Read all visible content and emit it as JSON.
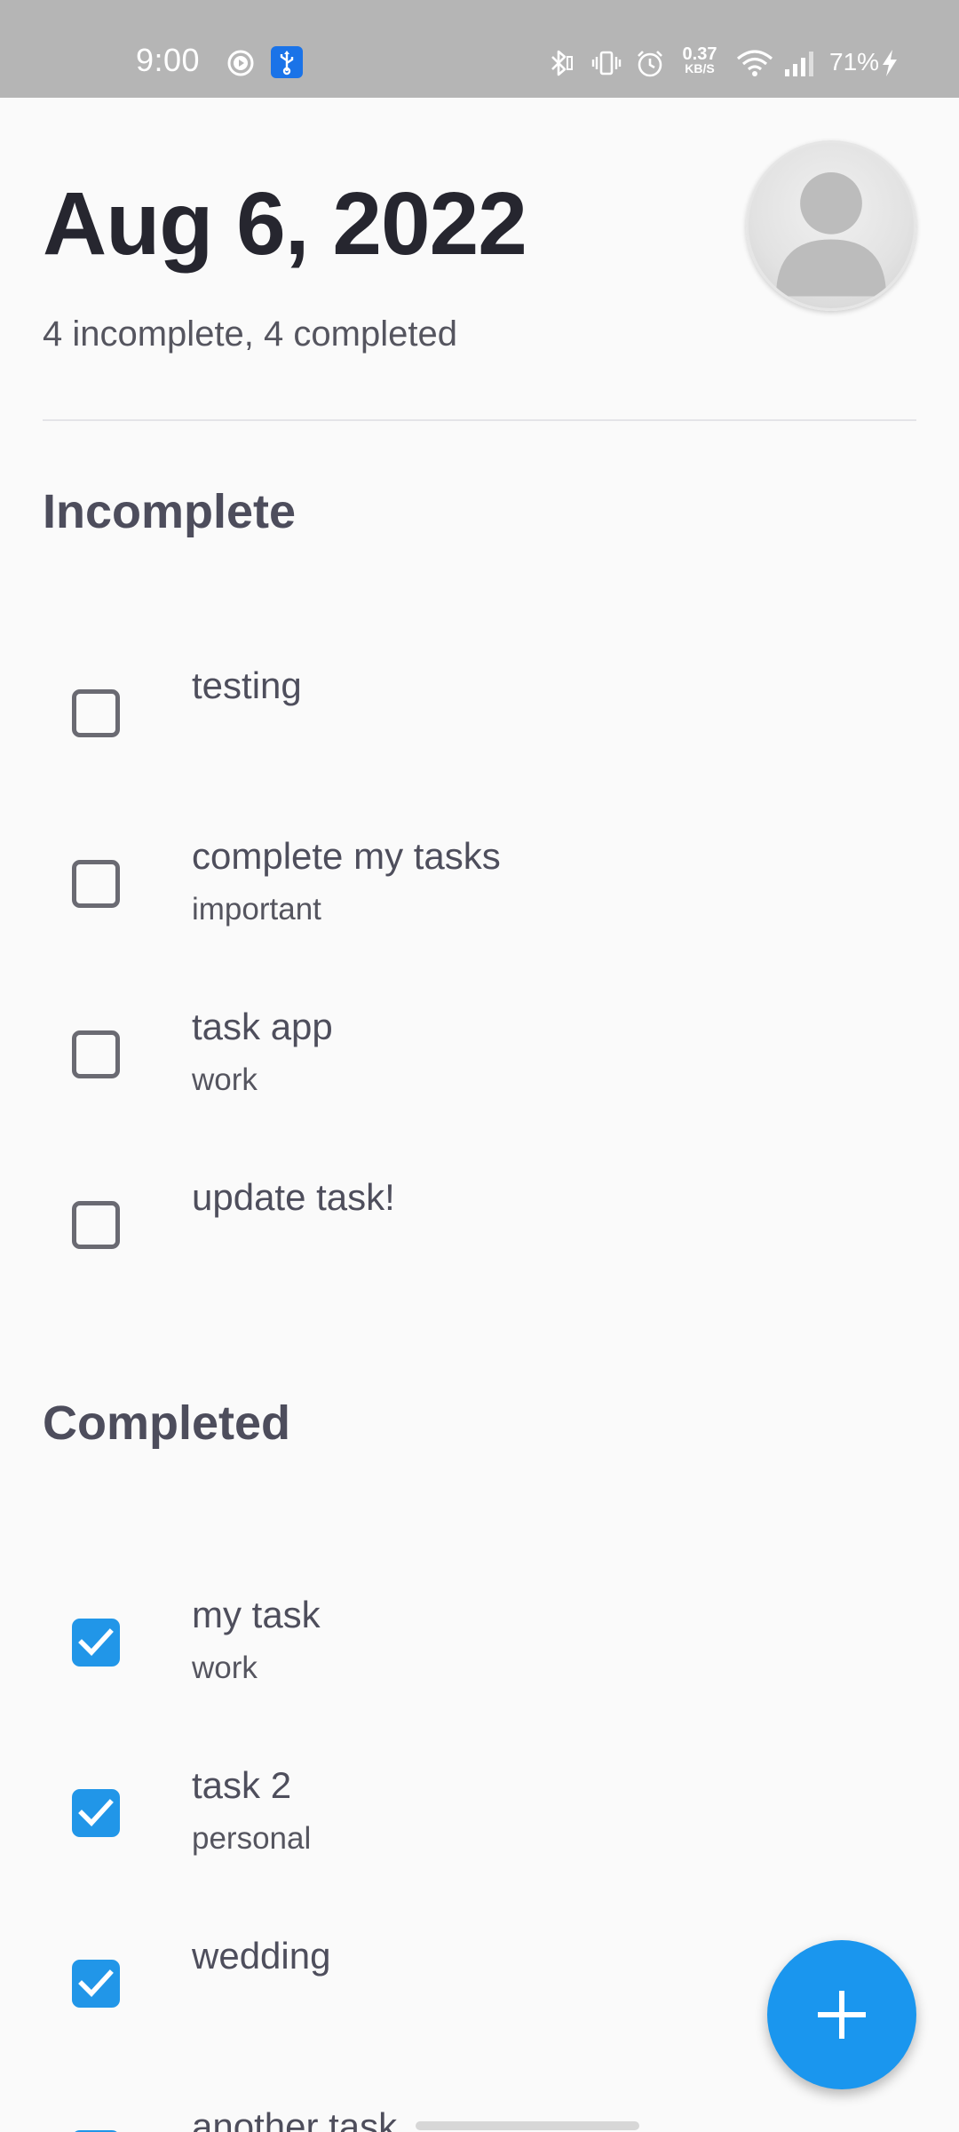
{
  "status_bar": {
    "time": "9:00",
    "speed_value": "0.37",
    "speed_unit": "KB/S",
    "battery": "71%",
    "icons": [
      "media-icon",
      "usb-icon",
      "bluetooth-icon",
      "vibrate-icon",
      "alarm-icon",
      "wifi-icon",
      "signal-icon",
      "charging-icon"
    ]
  },
  "header": {
    "date": "Aug 6, 2022",
    "summary": "4 incomplete, 4 completed"
  },
  "sections": {
    "incomplete": {
      "title": "Incomplete",
      "tasks": [
        {
          "title": "testing",
          "tag": ""
        },
        {
          "title": "complete my tasks",
          "tag": "important"
        },
        {
          "title": "task app",
          "tag": "work"
        },
        {
          "title": "update task!",
          "tag": ""
        }
      ]
    },
    "completed": {
      "title": "Completed",
      "tasks": [
        {
          "title": "my task",
          "tag": "work"
        },
        {
          "title": "task 2",
          "tag": "personal"
        },
        {
          "title": "wedding",
          "tag": ""
        },
        {
          "title": "another task",
          "tag": ""
        }
      ]
    }
  },
  "colors": {
    "accent": "#2196e8",
    "fab": "#1a96ee",
    "status_bar": "#b5b5b5",
    "title_text": "#26262f"
  },
  "fab": {
    "icon": "plus-icon"
  }
}
